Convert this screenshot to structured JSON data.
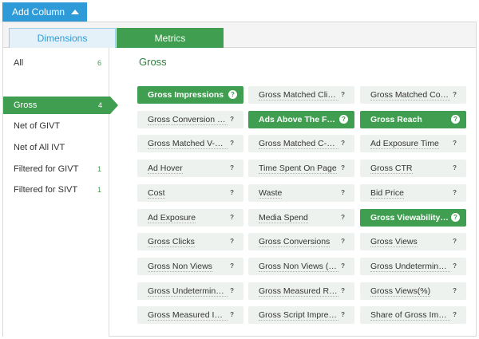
{
  "add_column_label": "Add Column",
  "tabs": [
    {
      "label": "Dimensions"
    },
    {
      "label": "Metrics"
    }
  ],
  "sidebar": {
    "items": [
      {
        "label": "All",
        "count": "6"
      },
      {
        "label": "Gross",
        "count": "4"
      },
      {
        "label": "Net of GIVT",
        "count": ""
      },
      {
        "label": "Net of All IVT",
        "count": ""
      },
      {
        "label": "Filtered for GIVT",
        "count": "1"
      },
      {
        "label": "Filtered for SIVT",
        "count": "1"
      }
    ],
    "active_index": 1
  },
  "section_title": "Gross",
  "metrics": [
    {
      "label": "Gross Impressions",
      "selected": true,
      "help": "?"
    },
    {
      "label": "Gross Matched Clicks",
      "selected": false,
      "help": "?"
    },
    {
      "label": "Gross Matched Conv...",
      "selected": false,
      "help": "?"
    },
    {
      "label": "Gross Conversion Rate",
      "selected": false,
      "help": "?"
    },
    {
      "label": "Ads Above The Fold",
      "selected": true,
      "help": "?"
    },
    {
      "label": "Gross Reach",
      "selected": true,
      "help": "?"
    },
    {
      "label": "Gross Matched V-Co...",
      "selected": false,
      "help": "?"
    },
    {
      "label": "Gross Matched C-Co...",
      "selected": false,
      "help": "?"
    },
    {
      "label": "Ad Exposure Time",
      "selected": false,
      "help": "?"
    },
    {
      "label": "Ad Hover",
      "selected": false,
      "help": "?"
    },
    {
      "label": "Time Spent On Page",
      "selected": false,
      "help": "?"
    },
    {
      "label": "Gross CTR",
      "selected": false,
      "help": "?"
    },
    {
      "label": "Cost",
      "selected": false,
      "help": "?"
    },
    {
      "label": "Waste",
      "selected": false,
      "help": "?"
    },
    {
      "label": "Bid Price",
      "selected": false,
      "help": "?"
    },
    {
      "label": "Ad Exposure",
      "selected": false,
      "help": "?"
    },
    {
      "label": "Media Spend",
      "selected": false,
      "help": "?"
    },
    {
      "label": "Gross Viewability(%)",
      "selected": true,
      "help": "?"
    },
    {
      "label": "Gross Clicks",
      "selected": false,
      "help": "?"
    },
    {
      "label": "Gross Conversions",
      "selected": false,
      "help": "?"
    },
    {
      "label": "Gross Views",
      "selected": false,
      "help": "?"
    },
    {
      "label": "Gross Non Views",
      "selected": false,
      "help": "?"
    },
    {
      "label": "Gross Non Views (%)",
      "selected": false,
      "help": "?"
    },
    {
      "label": "Gross Undetermined...",
      "selected": false,
      "help": "?"
    },
    {
      "label": "Gross Undetermined...",
      "selected": false,
      "help": "?"
    },
    {
      "label": "Gross Measured Rat...",
      "selected": false,
      "help": "?"
    },
    {
      "label": "Gross Views(%)",
      "selected": false,
      "help": "?"
    },
    {
      "label": "Gross Measured Imp...",
      "selected": false,
      "help": "?"
    },
    {
      "label": "Gross Script Impress...",
      "selected": false,
      "help": "?"
    },
    {
      "label": "Share of Gross Impr...",
      "selected": false,
      "help": "?"
    }
  ],
  "colors": {
    "accent_blue": "#2e9bd8",
    "accent_green": "#3f9e4f"
  }
}
